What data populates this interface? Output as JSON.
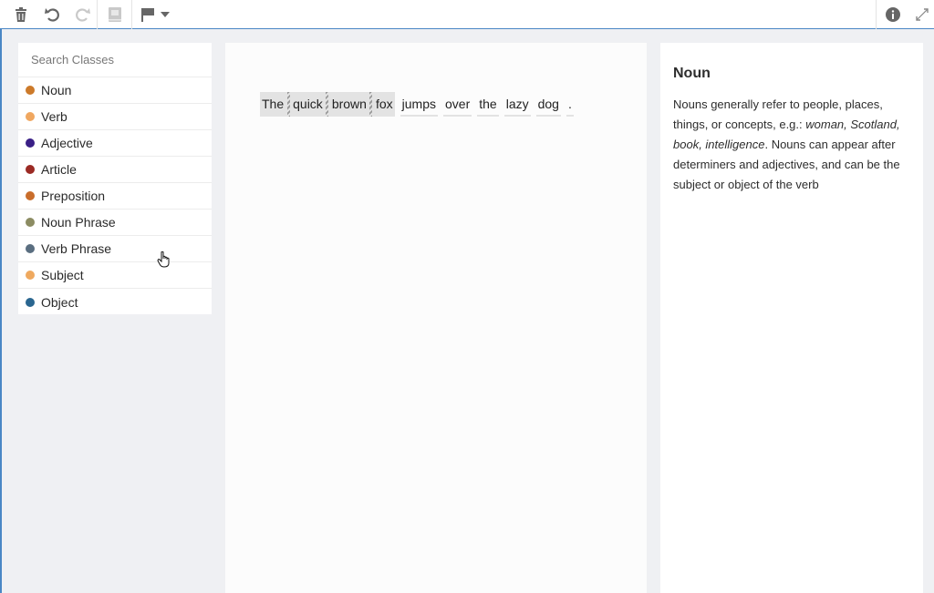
{
  "toolbar": {
    "icons": [
      "trash-icon",
      "undo-icon",
      "redo-icon",
      "book-icon",
      "flag-icon",
      "chevron-down-icon",
      "info-icon",
      "expand-icon"
    ]
  },
  "sidebar": {
    "search_placeholder": "Search Classes",
    "items": [
      {
        "label": "Noun",
        "color": "#cc7a2a"
      },
      {
        "label": "Verb",
        "color": "#f0a760"
      },
      {
        "label": "Adjective",
        "color": "#3a1f86"
      },
      {
        "label": "Article",
        "color": "#9b2a24"
      },
      {
        "label": "Preposition",
        "color": "#c96d2b"
      },
      {
        "label": "Noun Phrase",
        "color": "#8c8c62"
      },
      {
        "label": "Verb Phrase",
        "color": "#5a6e80"
      },
      {
        "label": "Subject",
        "color": "#efa95f"
      },
      {
        "label": "Object",
        "color": "#2a6690"
      }
    ]
  },
  "editor": {
    "tokens": [
      "The",
      "quick",
      "brown",
      "fox",
      "jumps",
      "over",
      "the",
      "lazy",
      "dog",
      "."
    ]
  },
  "info": {
    "title": "Noun",
    "desc_intro": "Nouns generally refer to people, places, things, or concepts, e.g.: ",
    "desc_examples": "woman, Scotland, book, intelligence",
    "desc_rest": ". Nouns can appear after determiners and adjectives, and can be the subject or object of the verb"
  }
}
